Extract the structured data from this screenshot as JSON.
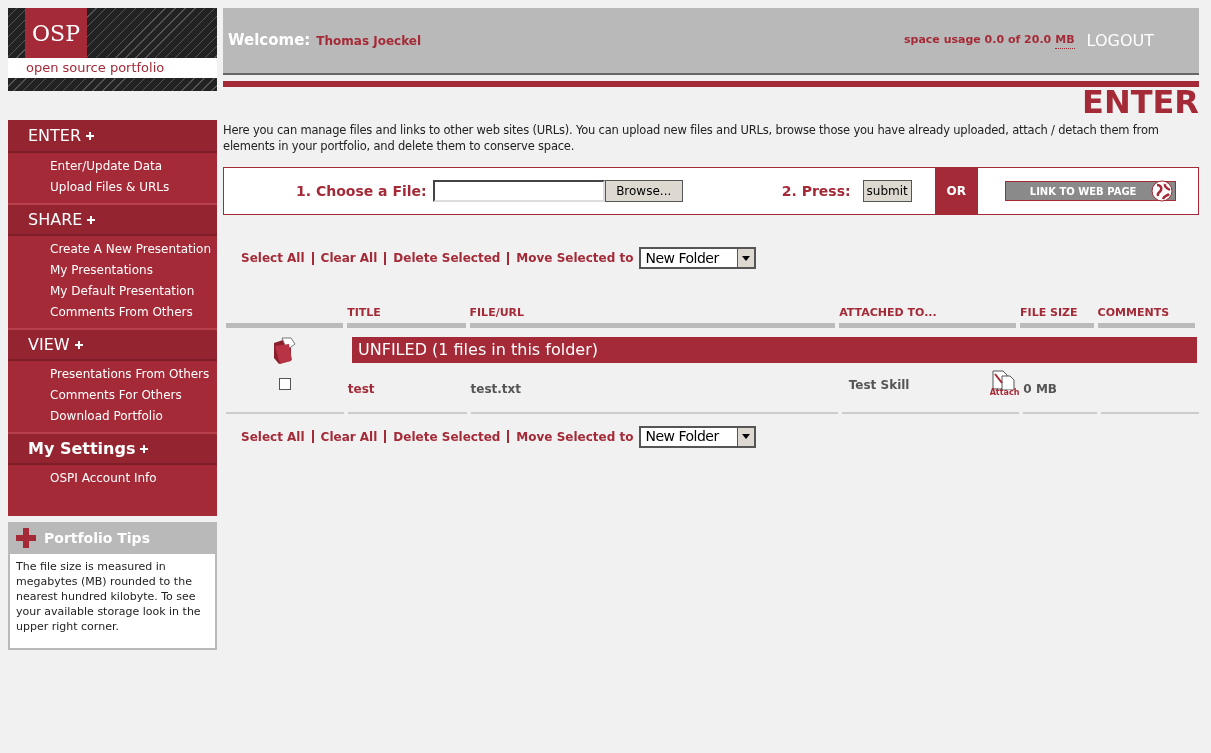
{
  "logo": {
    "mark": "OSP",
    "tagline": "open source portfolio"
  },
  "header": {
    "welcome_label": "Welcome:",
    "user_name": "Thomas Joeckel",
    "space_usage": "space usage 0.0 of 20.0",
    "space_unit": "MB",
    "logout": "LOGOUT"
  },
  "page_title": "ENTER",
  "description": "Here you can manage files and links to other web sites (URLs). You can upload new files and URLs, browse those you have already uploaded, attach / detach them from elements in your portfolio, and delete them to conserve space.",
  "upload": {
    "choose_label": "1. Choose a File:",
    "browse_button": "Browse...",
    "press_label": "2. Press:",
    "submit_button": "submit",
    "or_label": "OR",
    "link_button": "LINK TO WEB PAGE"
  },
  "actions_top": {
    "links": [
      "Select All",
      "Clear All",
      "Delete Selected"
    ],
    "move_label": "Move Selected to",
    "folder_select": "New Folder"
  },
  "table": {
    "columns": [
      "TITLE",
      "FILE/URL",
      "ATTACHED TO...",
      "FILE SIZE",
      "COMMENTS"
    ],
    "folder": "UNFILED (1 files in this folder)",
    "rows": [
      {
        "checked": false,
        "title": "test",
        "file": "test.txt",
        "attached_to": "Test Skill",
        "attach_label": "Attach",
        "file_size": "0 MB"
      }
    ]
  },
  "actions_bottom": {
    "links": [
      "Select All",
      "Clear All",
      "Delete Selected"
    ],
    "move_label": "Move Selected to",
    "folder_select": "New Folder"
  },
  "sidebar": {
    "sections": [
      {
        "title": "ENTER",
        "items": [
          {
            "label": "Enter/Update Data"
          },
          {
            "label": "Upload Files & URLs"
          }
        ]
      },
      {
        "title": "SHARE",
        "items": [
          {
            "label": "Create A New Presentation"
          },
          {
            "label": "My Presentations"
          },
          {
            "label": "My Default Presentation"
          },
          {
            "label": "Comments From Others"
          }
        ]
      },
      {
        "title": "VIEW",
        "items": [
          {
            "label": "Presentations From Others"
          },
          {
            "label": "Comments For Others"
          },
          {
            "label": "Download Portfolio"
          }
        ]
      },
      {
        "title": "My Settings",
        "items": [
          {
            "label": "OSPI Account Info"
          }
        ]
      }
    ]
  },
  "tips": {
    "title": "Portfolio Tips",
    "text": "The file size is measured in megabytes (MB) rounded to the nearest hundred kilobyte. To see your available storage look in the upper right corner."
  }
}
